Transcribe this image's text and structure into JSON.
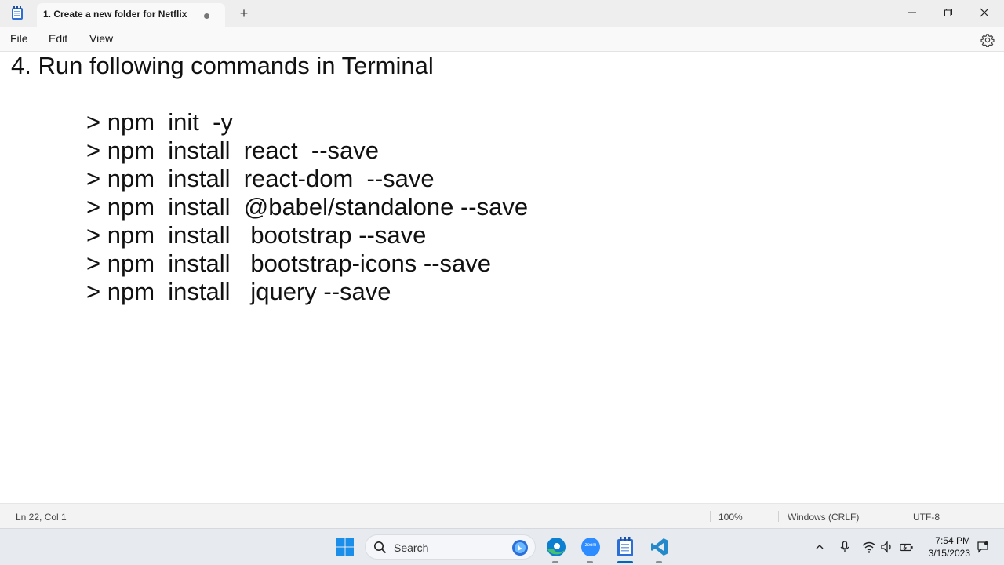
{
  "window": {
    "tab_title": "1. Create a new folder for Netflix"
  },
  "menu": {
    "file": "File",
    "edit": "Edit",
    "view": "View"
  },
  "editor": {
    "lines": [
      "4. Run following commands in Terminal",
      "> npm  init  -y",
      "> npm  install  react  --save",
      "> npm  install  react-dom  --save",
      "> npm  install  @babel/standalone --save",
      "> npm  install   bootstrap --save",
      "> npm  install   bootstrap-icons --save",
      "> npm  install   jquery --save"
    ]
  },
  "status": {
    "position": "Ln 22, Col 1",
    "zoom": "100%",
    "line_ending": "Windows (CRLF)",
    "encoding": "UTF-8"
  },
  "taskbar": {
    "search_label": "Search",
    "zoom_label": "zoom",
    "time": "7:54 PM",
    "date": "3/15/2023"
  },
  "colors": {
    "accent": "#0067c0",
    "edge_blue": "#0c7fd1",
    "edge_green": "#45c16d",
    "vscode_blue": "#2489ca",
    "zoom_blue": "#2d8cff"
  },
  "icons": [
    "notepad-icon",
    "close-icon",
    "plus-icon",
    "minimize-icon",
    "maximize-icon",
    "gear-icon",
    "windows-icon",
    "search-icon",
    "bing-icon",
    "edge-icon",
    "zoom-icon",
    "vscode-icon",
    "chevron-up-icon",
    "microphone-icon",
    "wifi-icon",
    "speaker-icon",
    "battery-icon",
    "notification-icon"
  ]
}
